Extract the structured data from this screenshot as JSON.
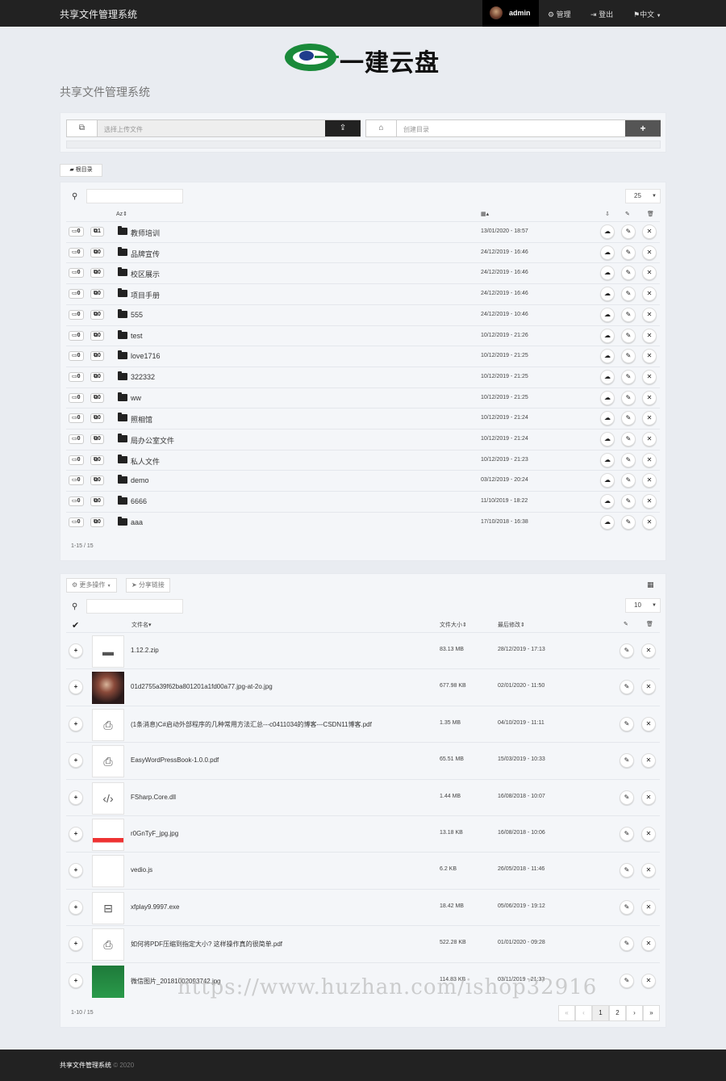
{
  "nav": {
    "brand": "共享文件管理系统",
    "user": "admin",
    "manage": "管理",
    "logout": "登出",
    "lang": "中文"
  },
  "logo_text": "一建云盘",
  "subtitle": "共享文件管理系统",
  "upload": {
    "upload_placeholder": "选择上传文件",
    "mkdir_placeholder": "创建目录",
    "add": "+"
  },
  "root_label": "根目录",
  "folder_table": {
    "page_size": "25",
    "sort_hint": "Az",
    "folders": [
      {
        "dirs": "0",
        "files": "1",
        "name": "教师培训",
        "date": "13/01/2020 - 18:57"
      },
      {
        "dirs": "0",
        "files": "0",
        "name": "品牌宣传",
        "date": "24/12/2019 - 16:46"
      },
      {
        "dirs": "0",
        "files": "0",
        "name": "校区展示",
        "date": "24/12/2019 - 16:46"
      },
      {
        "dirs": "0",
        "files": "0",
        "name": "项目手册",
        "date": "24/12/2019 - 16:46"
      },
      {
        "dirs": "0",
        "files": "0",
        "name": "555",
        "date": "24/12/2019 - 10:46"
      },
      {
        "dirs": "0",
        "files": "0",
        "name": "test",
        "date": "10/12/2019 - 21:26"
      },
      {
        "dirs": "0",
        "files": "0",
        "name": "love1716",
        "date": "10/12/2019 - 21:25"
      },
      {
        "dirs": "0",
        "files": "0",
        "name": "322332",
        "date": "10/12/2019 - 21:25"
      },
      {
        "dirs": "0",
        "files": "0",
        "name": "ww",
        "date": "10/12/2019 - 21:25"
      },
      {
        "dirs": "0",
        "files": "0",
        "name": "照相馆",
        "date": "10/12/2019 - 21:24"
      },
      {
        "dirs": "0",
        "files": "0",
        "name": "局办公室文件",
        "date": "10/12/2019 - 21:24"
      },
      {
        "dirs": "0",
        "files": "0",
        "name": "私人文件",
        "date": "10/12/2019 - 21:23"
      },
      {
        "dirs": "0",
        "files": "0",
        "name": "demo",
        "date": "03/12/2019 - 20:24"
      },
      {
        "dirs": "0",
        "files": "0",
        "name": "6666",
        "date": "11/10/2019 - 18:22"
      },
      {
        "dirs": "0",
        "files": "0",
        "name": "aaa",
        "date": "17/10/2018 - 16:38"
      }
    ],
    "count": "1-15 / 15"
  },
  "file_table": {
    "more_actions": "更多操作",
    "share_link": "分享链接",
    "page_size": "10",
    "col_name": "文件名",
    "col_size": "文件大小",
    "col_modified": "最后修改",
    "files": [
      {
        "name": "1.12.2.zip",
        "size": "83.13 MB",
        "date": "28/12/2019 - 17:13",
        "icon": "archive-icon"
      },
      {
        "name": "01d2755a39f62ba801201a1fd00a77.jpg-at-2o.jpg",
        "size": "677.98 KB",
        "date": "02/01/2020 - 11:50",
        "icon": "photo-thumb"
      },
      {
        "name": "(1条消息)C#启动外部程序的几种常用方法汇总---c0411034的博客---CSDN11博客.pdf",
        "size": "1.35 MB",
        "date": "04/10/2019 - 11:11",
        "icon": "pdf-icon"
      },
      {
        "name": "EasyWordPressBook-1.0.0.pdf",
        "size": "65.51 MB",
        "date": "15/03/2019 - 10:33",
        "icon": "pdf-icon"
      },
      {
        "name": "FSharp.Core.dll",
        "size": "1.44 MB",
        "date": "16/08/2018 - 10:07",
        "icon": "code-file-icon"
      },
      {
        "name": "r0GnTyF_jpg.jpg",
        "size": "13.18 KB",
        "date": "16/08/2018 - 10:06",
        "icon": "screenshot-thumb"
      },
      {
        "name": "vedio.js",
        "size": "6.2 KB",
        "date": "26/05/2018 - 11:46",
        "icon": "code-icon"
      },
      {
        "name": "xfplay9.9997.exe",
        "size": "18.42 MB",
        "date": "05/06/2019 - 19:12",
        "icon": "drive-icon"
      },
      {
        "name": "如何将PDF压缩到指定大小? 这样操作真的很简单.pdf",
        "size": "522.28 KB",
        "date": "01/01/2020 - 09:28",
        "icon": "pdf-icon"
      },
      {
        "name": "微信图片_20181002093742.jpg",
        "size": "114.83 KB",
        "date": "03/11/2019 - 21:33",
        "icon": "green-thumb"
      }
    ],
    "count": "1-10 / 15",
    "pages": [
      "«",
      "‹",
      "1",
      "2",
      "›",
      "»"
    ]
  },
  "watermark": "https://www.huzhan.com/ishop32916",
  "footer": {
    "brand": "共享文件管理系统",
    "copy": "© 2020"
  },
  "colors": {
    "navbar": "#222222",
    "logo_green": "#1a8a3a",
    "logo_blue": "#1f3d8c",
    "body_bg": "#e9ecf1"
  }
}
